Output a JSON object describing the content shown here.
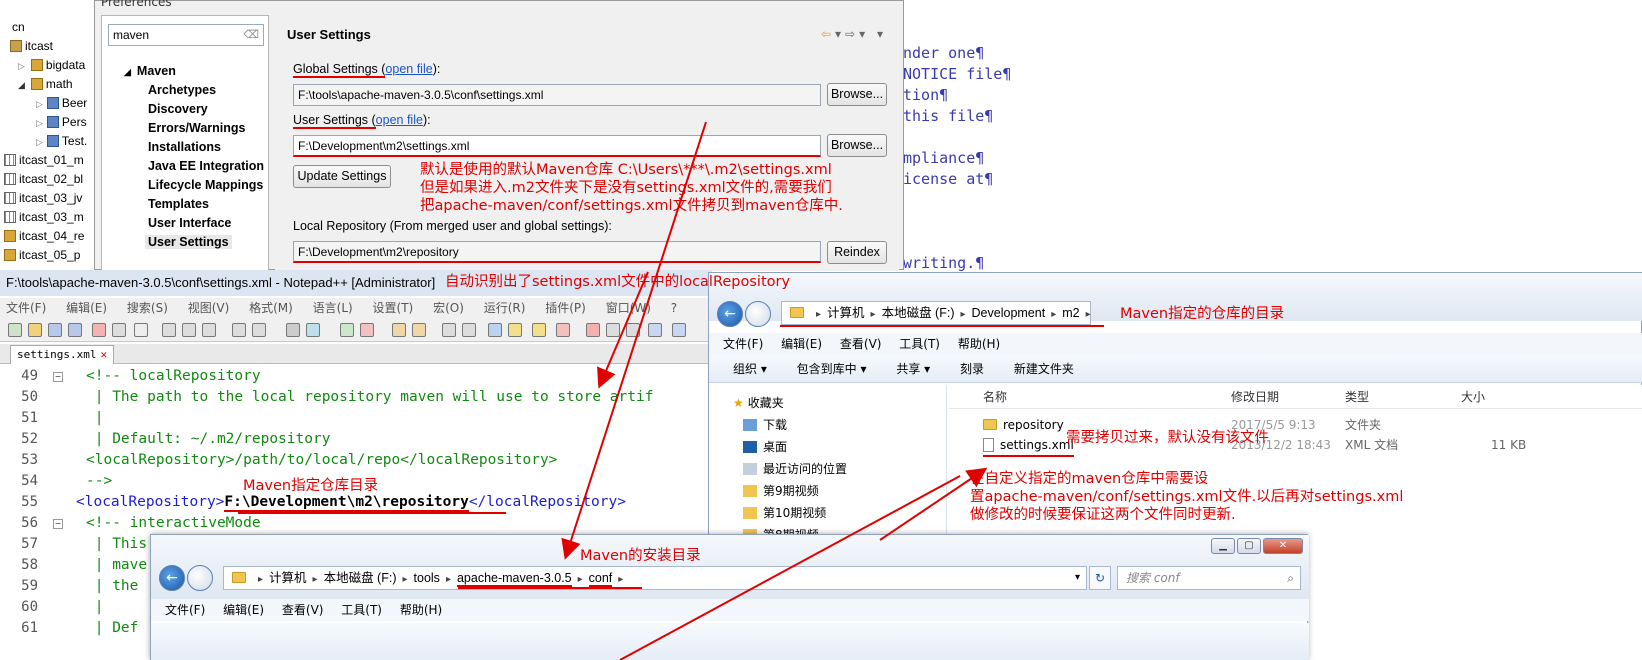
{
  "explorer": {
    "root": "cn",
    "items": [
      {
        "label": "itcast",
        "icon": "project-icon"
      },
      {
        "label": "bigdata",
        "icon": "package-icon"
      },
      {
        "label": "math",
        "icon": "package-icon"
      },
      {
        "label": "Beer",
        "icon": "java-file-icon"
      },
      {
        "label": "Pers",
        "icon": "java-file-icon"
      },
      {
        "label": "Test.",
        "icon": "java-file-icon"
      },
      {
        "label": "itcast_01_m",
        "icon": "maven-project-icon"
      },
      {
        "label": "itcast_02_bl",
        "icon": "maven-project-icon"
      },
      {
        "label": "itcast_03_jv",
        "icon": "maven-project-icon"
      },
      {
        "label": "itcast_03_m",
        "icon": "maven-project-icon"
      },
      {
        "label": "itcast_04_re",
        "icon": "maven-project-icon"
      },
      {
        "label": "itcast_05_p",
        "icon": "maven-project-icon"
      }
    ]
  },
  "bg_editor_lines": [
    "nder one¶",
    "NOTICE file¶",
    "tion¶",
    "this file¶",
    "mpliance¶",
    "icense at¶",
    "writing.¶"
  ],
  "prefs": {
    "title": "Preferences",
    "filter_value": "maven",
    "tree_root": "Maven",
    "tree_items": [
      "Archetypes",
      "Discovery",
      "Errors/Warnings",
      "Installations",
      "Java EE Integration",
      "Lifecycle Mappings",
      "Templates",
      "User Interface"
    ],
    "tree_selected": "User Settings",
    "heading": "User Settings",
    "global_label": "Global Settings (",
    "global_link": "open file",
    "global_label_end": "):",
    "global_path": "F:\\tools\\apache-maven-3.0.5\\conf\\settings.xml",
    "user_label": "User Settings (",
    "user_link": "open file",
    "user_label_end": "):",
    "user_path": "F:\\Development\\m2\\settings.xml",
    "browse_label": "Browse...",
    "update_label": "Update Settings",
    "local_repo_label": "Local Repository (From merged user and global settings):",
    "local_repo_path": "F:\\Development\\m2\\repository",
    "reindex_label": "Reindex"
  },
  "npp": {
    "title": "F:\\tools\\apache-maven-3.0.5\\conf\\settings.xml - Notepad++ [Administrator]",
    "menu": [
      "文件(F)",
      "编辑(E)",
      "搜索(S)",
      "视图(V)",
      "格式(M)",
      "语言(L)",
      "设置(T)",
      "宏(O)",
      "运行(R)",
      "插件(P)",
      "窗口(W)",
      "?"
    ],
    "tab_label": "settings.xml",
    "tab_close": "✕",
    "lines": [
      {
        "num": "49",
        "text": "<!-- localRepository"
      },
      {
        "num": "50",
        "text": " | The path to the local repository maven will use to store artif"
      },
      {
        "num": "51",
        "text": " |"
      },
      {
        "num": "52",
        "text": " | Default: ~/.m2/repository"
      },
      {
        "num": "53",
        "text": "<localRepository>/path/to/local/repo</localRepository>"
      },
      {
        "num": "54",
        "text": "-->"
      },
      {
        "num": "55",
        "tag_open": "<localRepository>",
        "value": "F:\\Development\\m2\\repository",
        "tag_close": "</localRepository>"
      },
      {
        "num": "56",
        "text": "<!-- interactiveMode"
      },
      {
        "num": "57",
        "text": " | This"
      },
      {
        "num": "58",
        "text": " | mave"
      },
      {
        "num": "59",
        "text": " | the"
      },
      {
        "num": "60",
        "text": " |"
      },
      {
        "num": "61",
        "text": " | Def"
      }
    ]
  },
  "m2_explorer": {
    "breadcrumbs": [
      "计算机",
      "本地磁盘 (F:)",
      "Development",
      "m2"
    ],
    "menu": [
      "文件(F)",
      "编辑(E)",
      "查看(V)",
      "工具(T)",
      "帮助(H)"
    ],
    "commands": [
      "组织 ▾",
      "包含到库中 ▾",
      "共享 ▾",
      "刻录",
      "新建文件夹"
    ],
    "nav": [
      "收藏夹",
      "下载",
      "桌面",
      "最近访问的位置",
      "第9期视频",
      "第10期视频",
      "第8期视频"
    ],
    "columns": [
      "名称",
      "修改日期",
      "类型",
      "大小"
    ],
    "files": [
      {
        "name": "repository",
        "date": "2017/5/5 9:13",
        "type": "文件夹",
        "size": ""
      },
      {
        "name": "settings.xml",
        "date": "2013/12/2 18:43",
        "type": "XML 文档",
        "size": "11 KB"
      }
    ]
  },
  "conf_explorer": {
    "breadcrumbs": [
      "计算机",
      "本地磁盘 (F:)",
      "tools",
      "apache-maven-3.0.5",
      "conf"
    ],
    "search_placeholder": "搜索 conf",
    "menu": [
      "文件(F)",
      "编辑(E)",
      "查看(V)",
      "工具(T)",
      "帮助(H)"
    ],
    "window_buttons": [
      "▁",
      "▢",
      "✕"
    ]
  },
  "annotations": {
    "default_repo_line1": "默认是使用的默认Maven仓库 C:\\Users\\***\\.m2\\settings.xml",
    "default_repo_line2": "但是如果进入.m2文件夹下是没有settings.xml文件的,需要我们",
    "default_repo_line3": "把apache-maven/conf/settings.xml文件拷贝到maven仓库中.",
    "auto_detect": "自动识别出了settings.xml文件中的localRepository",
    "m2_dir": "Maven指定的仓库的目录",
    "copy_over": "需要拷贝过来，默认没有该文件",
    "custom_line1": "在自定义指定的maven仓库中需要设",
    "custom_line2": "置apache-maven/conf/settings.xml文件.以后再对settings.xml",
    "custom_line3": "做修改的时候要保证这两个文件同时更新.",
    "repo_dir": "Maven指定仓库目录",
    "install_dir": "Maven的安装目录"
  },
  "colors": {
    "annotation": "#e00000",
    "comment": "#118a11",
    "tag": "#1d1dd6",
    "link": "#1a55c8"
  }
}
